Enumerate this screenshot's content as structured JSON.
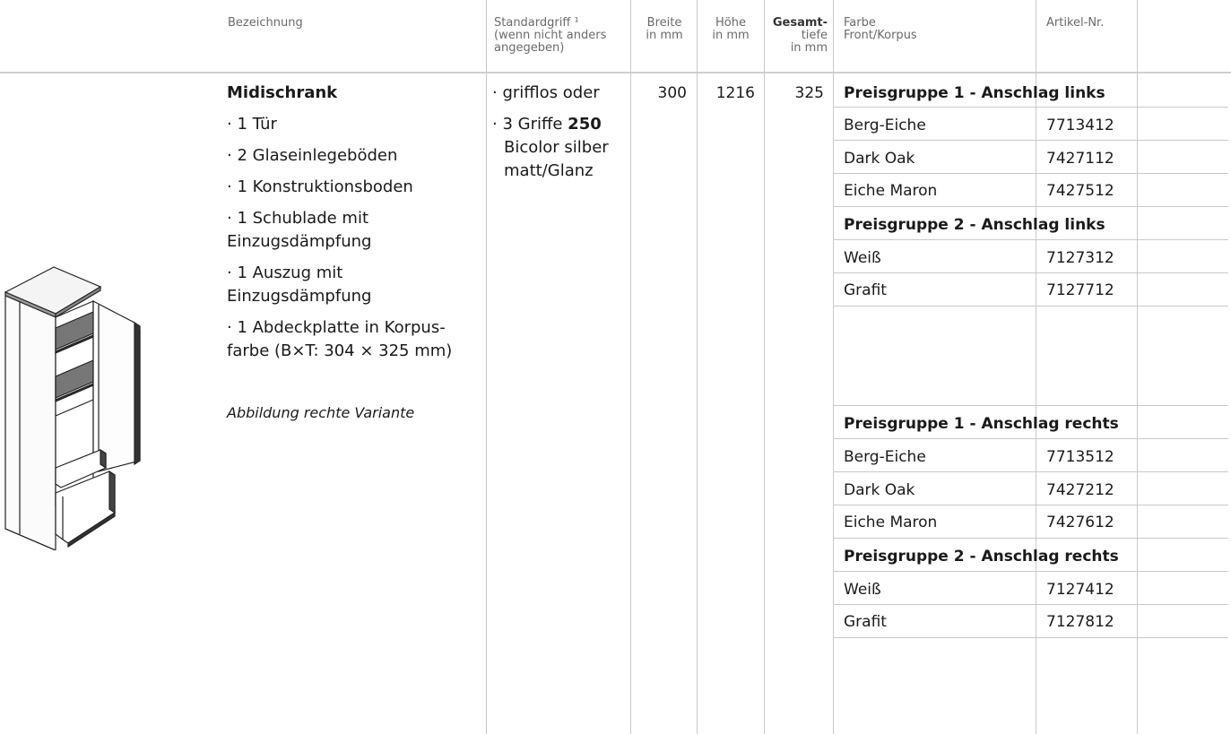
{
  "header": {
    "bezeichnung": "Bezeichnung",
    "griff": [
      "Standardgriff ¹",
      "(wenn nicht anders",
      "angegeben)"
    ],
    "breite": [
      "Breite",
      "in mm"
    ],
    "hoehe": [
      "Höhe",
      "in mm"
    ],
    "tiefe": [
      "Gesamt-",
      "tiefe",
      "in mm"
    ],
    "farbe": [
      "Farbe",
      "Front/Korpus"
    ],
    "artikel": "Artikel-Nr."
  },
  "product": {
    "name": "Midischrank",
    "features": [
      "· 1 Tür",
      "· 2 Glaseinlegeböden",
      "· 1 Konstruktionsboden",
      "· 1 Schublade mit",
      "Einzugsdämpfung",
      "· 1 Auszug mit",
      "Einzugsdämpfung",
      "· 1 Abdeckplatte in Korpus-",
      "farbe (B×T: 304 × 325 mm)"
    ],
    "caption": "Abbildung rechte Variante",
    "griff_lines": {
      "l1": "· grifflos oder",
      "l2_pre": "· 3 Griffe ",
      "l2_bold": "250",
      "l3": "Bicolor silber",
      "l4": "matt/Glanz"
    },
    "breite": "300",
    "hoehe": "1216",
    "tiefe": "325"
  },
  "groups": [
    {
      "title": "Preisgruppe 1 - Anschlag links",
      "rows": [
        {
          "farbe": "Berg-Eiche",
          "nr": "7713412"
        },
        {
          "farbe": "Dark Oak",
          "nr": "7427112"
        },
        {
          "farbe": "Eiche Maron",
          "nr": "7427512"
        }
      ]
    },
    {
      "title": "Preisgruppe 2 - Anschlag links",
      "rows": [
        {
          "farbe": "Weiß",
          "nr": "7127312"
        },
        {
          "farbe": "Grafit",
          "nr": "7127712"
        }
      ]
    },
    {
      "title": "Preisgruppe 1 - Anschlag rechts",
      "rows": [
        {
          "farbe": "Berg-Eiche",
          "nr": "7713512"
        },
        {
          "farbe": "Dark Oak",
          "nr": "7427212"
        },
        {
          "farbe": "Eiche Maron",
          "nr": "7427612"
        }
      ]
    },
    {
      "title": "Preisgruppe 2 - Anschlag rechts",
      "rows": [
        {
          "farbe": "Weiß",
          "nr": "7127412"
        },
        {
          "farbe": "Grafit",
          "nr": "7127812"
        }
      ]
    }
  ]
}
